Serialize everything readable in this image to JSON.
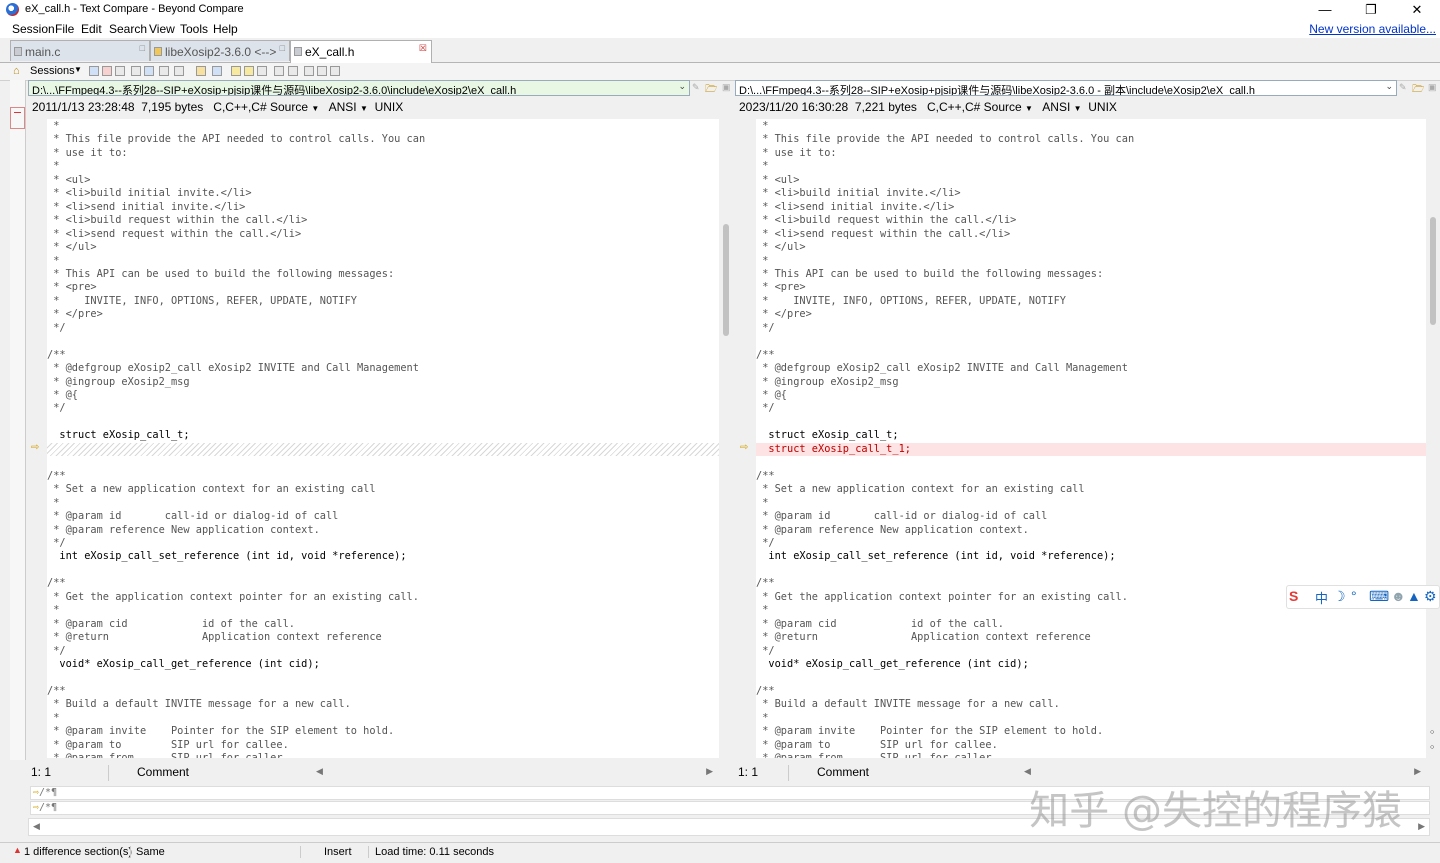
{
  "window": {
    "title": "eX_call.h - Text Compare - Beyond Compare"
  },
  "menu": {
    "items": [
      "Session",
      "File",
      "Edit",
      "Search",
      "View",
      "Tools",
      "Help"
    ],
    "new_version": "New version available..."
  },
  "tabs": [
    {
      "label": "main.c"
    },
    {
      "label": "libeXosip2-3.6.0 <--> ..."
    },
    {
      "label": "eX_call.h"
    }
  ],
  "toolbar": {
    "sessions_label": "Sessions"
  },
  "left": {
    "path": "D:\\...\\FFmpeg4.3--系列28--SIP+eXosip+pjsip课件与源码\\libeXosip2-3.6.0\\include\\eXosip2\\eX_call.h",
    "timestamp": "2011/1/13 23:28:48",
    "size": "7,195 bytes",
    "format": "C,C++,C# Source",
    "encoding": "ANSI",
    "line_ending": "UNIX",
    "cursor": "1: 1",
    "mode": "Comment"
  },
  "right": {
    "path": "D:\\...\\FFmpeg4.3--系列28--SIP+eXosip+pjsip课件与源码\\libeXosip2-3.6.0 - 副本\\include\\eXosip2\\eX_call.h",
    "timestamp": "2023/11/20 16:30:28",
    "size": "7,221 bytes",
    "format": "C,C++,C# Source",
    "encoding": "ANSI",
    "line_ending": "UNIX",
    "cursor": "1: 1",
    "mode": "Comment"
  },
  "code_left": [
    {
      "t": " *",
      "k": "cm"
    },
    {
      "t": " * This file provide the API needed to control calls. You can",
      "k": "cm"
    },
    {
      "t": " * use it to:",
      "k": "cm"
    },
    {
      "t": " *",
      "k": "cm"
    },
    {
      "t": " * <ul>",
      "k": "cm"
    },
    {
      "t": " * <li>build initial invite.</li>",
      "k": "cm"
    },
    {
      "t": " * <li>send initial invite.</li>",
      "k": "cm"
    },
    {
      "t": " * <li>build request within the call.</li>",
      "k": "cm"
    },
    {
      "t": " * <li>send request within the call.</li>",
      "k": "cm"
    },
    {
      "t": " * </ul>",
      "k": "cm"
    },
    {
      "t": " *",
      "k": "cm"
    },
    {
      "t": " * This API can be used to build the following messages:",
      "k": "cm"
    },
    {
      "t": " * <pre>",
      "k": "cm"
    },
    {
      "t": " *    INVITE, INFO, OPTIONS, REFER, UPDATE, NOTIFY",
      "k": "cm"
    },
    {
      "t": " * </pre>",
      "k": "cm"
    },
    {
      "t": " */",
      "k": "cm"
    },
    {
      "t": "",
      "k": "cm"
    },
    {
      "t": "/**",
      "k": "cm"
    },
    {
      "t": " * @defgroup eXosip2_call eXosip2 INVITE and Call Management",
      "k": "cm"
    },
    {
      "t": " * @ingroup eXosip2_msg",
      "k": "cm"
    },
    {
      "t": " * @{",
      "k": "cm"
    },
    {
      "t": " */",
      "k": "cm"
    },
    {
      "t": "",
      "k": "cm"
    },
    {
      "t": "  struct eXosip_call_t;",
      "k": "code-b"
    },
    {
      "t": "",
      "k": "hatch"
    },
    {
      "t": "",
      "k": "cm"
    },
    {
      "t": "/**",
      "k": "cm"
    },
    {
      "t": " * Set a new application context for an existing call",
      "k": "cm"
    },
    {
      "t": " *",
      "k": "cm"
    },
    {
      "t": " * @param id       call-id or dialog-id of call",
      "k": "cm"
    },
    {
      "t": " * @param reference New application context.",
      "k": "cm"
    },
    {
      "t": " */",
      "k": "cm"
    },
    {
      "t": "  int eXosip_call_set_reference (int id, void *reference);",
      "k": "code-b"
    },
    {
      "t": "",
      "k": "cm"
    },
    {
      "t": "/**",
      "k": "cm"
    },
    {
      "t": " * Get the application context pointer for an existing call.",
      "k": "cm"
    },
    {
      "t": " *",
      "k": "cm"
    },
    {
      "t": " * @param cid            id of the call.",
      "k": "cm"
    },
    {
      "t": " * @return               Application context reference",
      "k": "cm"
    },
    {
      "t": " */",
      "k": "cm"
    },
    {
      "t": "  void* eXosip_call_get_reference (int cid);",
      "k": "code-b"
    },
    {
      "t": "",
      "k": "cm"
    },
    {
      "t": "/**",
      "k": "cm"
    },
    {
      "t": " * Build a default INVITE message for a new call.",
      "k": "cm"
    },
    {
      "t": " *",
      "k": "cm"
    },
    {
      "t": " * @param invite    Pointer for the SIP element to hold.",
      "k": "cm"
    },
    {
      "t": " * @param to        SIP url for callee.",
      "k": "cm"
    },
    {
      "t": " * @param from      SIP url for caller.",
      "k": "cm"
    }
  ],
  "code_right": [
    {
      "t": " *",
      "k": "cm"
    },
    {
      "t": " * This file provide the API needed to control calls. You can",
      "k": "cm"
    },
    {
      "t": " * use it to:",
      "k": "cm"
    },
    {
      "t": " *",
      "k": "cm"
    },
    {
      "t": " * <ul>",
      "k": "cm"
    },
    {
      "t": " * <li>build initial invite.</li>",
      "k": "cm"
    },
    {
      "t": " * <li>send initial invite.</li>",
      "k": "cm"
    },
    {
      "t": " * <li>build request within the call.</li>",
      "k": "cm"
    },
    {
      "t": " * <li>send request within the call.</li>",
      "k": "cm"
    },
    {
      "t": " * </ul>",
      "k": "cm"
    },
    {
      "t": " *",
      "k": "cm"
    },
    {
      "t": " * This API can be used to build the following messages:",
      "k": "cm"
    },
    {
      "t": " * <pre>",
      "k": "cm"
    },
    {
      "t": " *    INVITE, INFO, OPTIONS, REFER, UPDATE, NOTIFY",
      "k": "cm"
    },
    {
      "t": " * </pre>",
      "k": "cm"
    },
    {
      "t": " */",
      "k": "cm"
    },
    {
      "t": "",
      "k": "cm"
    },
    {
      "t": "/**",
      "k": "cm"
    },
    {
      "t": " * @defgroup eXosip2_call eXosip2 INVITE and Call Management",
      "k": "cm"
    },
    {
      "t": " * @ingroup eXosip2_msg",
      "k": "cm"
    },
    {
      "t": " * @{",
      "k": "cm"
    },
    {
      "t": " */",
      "k": "cm"
    },
    {
      "t": "",
      "k": "cm"
    },
    {
      "t": "  struct eXosip_call_t;",
      "k": "code-b"
    },
    {
      "t": "  struct eXosip_call_t_1;",
      "k": "diff"
    },
    {
      "t": "",
      "k": "cm"
    },
    {
      "t": "/**",
      "k": "cm"
    },
    {
      "t": " * Set a new application context for an existing call",
      "k": "cm"
    },
    {
      "t": " *",
      "k": "cm"
    },
    {
      "t": " * @param id       call-id or dialog-id of call",
      "k": "cm"
    },
    {
      "t": " * @param reference New application context.",
      "k": "cm"
    },
    {
      "t": " */",
      "k": "cm"
    },
    {
      "t": "  int eXosip_call_set_reference (int id, void *reference);",
      "k": "code-b"
    },
    {
      "t": "",
      "k": "cm"
    },
    {
      "t": "/**",
      "k": "cm"
    },
    {
      "t": " * Get the application context pointer for an existing call.",
      "k": "cm"
    },
    {
      "t": " *",
      "k": "cm"
    },
    {
      "t": " * @param cid            id of the call.",
      "k": "cm"
    },
    {
      "t": " * @return               Application context reference",
      "k": "cm"
    },
    {
      "t": " */",
      "k": "cm"
    },
    {
      "t": "  void* eXosip_call_get_reference (int cid);",
      "k": "code-b"
    },
    {
      "t": "",
      "k": "cm"
    },
    {
      "t": "/**",
      "k": "cm"
    },
    {
      "t": " * Build a default INVITE message for a new call.",
      "k": "cm"
    },
    {
      "t": " *",
      "k": "cm"
    },
    {
      "t": " * @param invite    Pointer for the SIP element to hold.",
      "k": "cm"
    },
    {
      "t": " * @param to        SIP url for callee.",
      "k": "cm"
    },
    {
      "t": " * @param from      SIP url for caller.",
      "k": "cm"
    }
  ],
  "compare_lines": [
    "/*¶",
    "/*¶"
  ],
  "statusbar": {
    "differences": "1 difference section(s)",
    "same": "Same",
    "insert": "Insert",
    "load_time": "Load time: 0.11 seconds"
  },
  "watermark": "知乎 @失控的程序猿",
  "colors": {
    "diff_bg": "#fde3e3",
    "diff_text": "#c00000",
    "left_path_bg": "#e8f7e4",
    "link": "#0033cc"
  }
}
